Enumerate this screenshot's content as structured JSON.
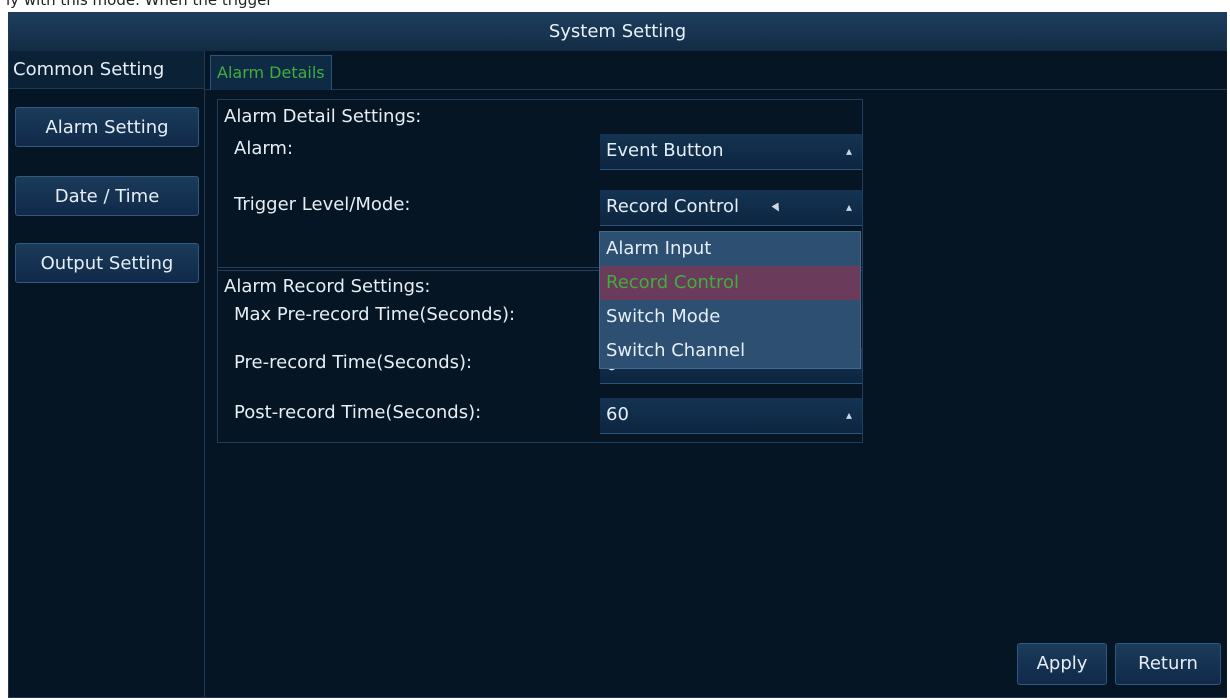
{
  "top_strip_text": "ly with this mode. When the trigger",
  "window": {
    "title": "System Setting"
  },
  "sidebar": {
    "active_label": "Common Setting",
    "items": [
      {
        "label": "Alarm Setting"
      },
      {
        "label": "Date / Time"
      },
      {
        "label": "Output Setting"
      }
    ]
  },
  "tabs": [
    {
      "label": "Alarm Details"
    }
  ],
  "alarm_detail": {
    "heading": "Alarm Detail Settings:",
    "alarm_label": "Alarm:",
    "alarm_value": "Event Button",
    "trigger_label": "Trigger Level/Mode:",
    "trigger_value": "Record Control",
    "trigger_options": [
      "Alarm Input",
      "Record Control",
      "Switch Mode",
      "Switch Channel"
    ],
    "trigger_selected_index": 1
  },
  "alarm_record": {
    "heading": "Alarm Record Settings:",
    "max_pre_label": "Max Pre-record Time(Seconds):",
    "pre_label": "Pre-record Time(Seconds):",
    "pre_value": "0",
    "post_label": "Post-record Time(Seconds):",
    "post_value": "60"
  },
  "actions": {
    "apply": "Apply",
    "return": "Return"
  }
}
